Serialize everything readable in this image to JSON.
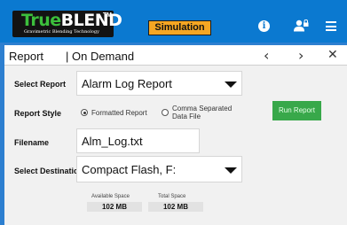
{
  "header": {
    "logo": {
      "brand_true": "True",
      "brand_blend": "BLEND",
      "trademark": "TM",
      "tagline": "Gravimetric Blending Technology"
    },
    "mode_badge": "Simulation",
    "info_icon": "i",
    "colors": {
      "header_bg": "#0b79d0",
      "badge": "#f5a623",
      "run_button": "#38a84a"
    }
  },
  "titlebar": {
    "section": "Report",
    "subsection": "| On Demand",
    "prev_glyph": "‹",
    "next_glyph": "›",
    "close_glyph": "✕"
  },
  "form": {
    "select_report": {
      "label": "Select Report",
      "value": "Alarm Log Report"
    },
    "report_style": {
      "label": "Report Style",
      "options": [
        "Formatted Report",
        "Comma Separated Data File"
      ],
      "selected": "Formatted Report"
    },
    "run_button": "Run Report",
    "filename": {
      "label": "Filename",
      "value": "Alm_Log.txt"
    },
    "select_destination": {
      "label": "Select Destination",
      "value": "Compact Flash, F:"
    },
    "available_space": {
      "label": "Available Space",
      "value": "102  MB"
    },
    "total_space": {
      "label": "Total Space",
      "value": "102  MB"
    }
  },
  "icons": [
    "info-icon",
    "user-lock-icon",
    "hamburger-menu-icon",
    "chevron-left-icon",
    "chevron-right-icon",
    "close-icon",
    "dropdown-caret-icon"
  ]
}
